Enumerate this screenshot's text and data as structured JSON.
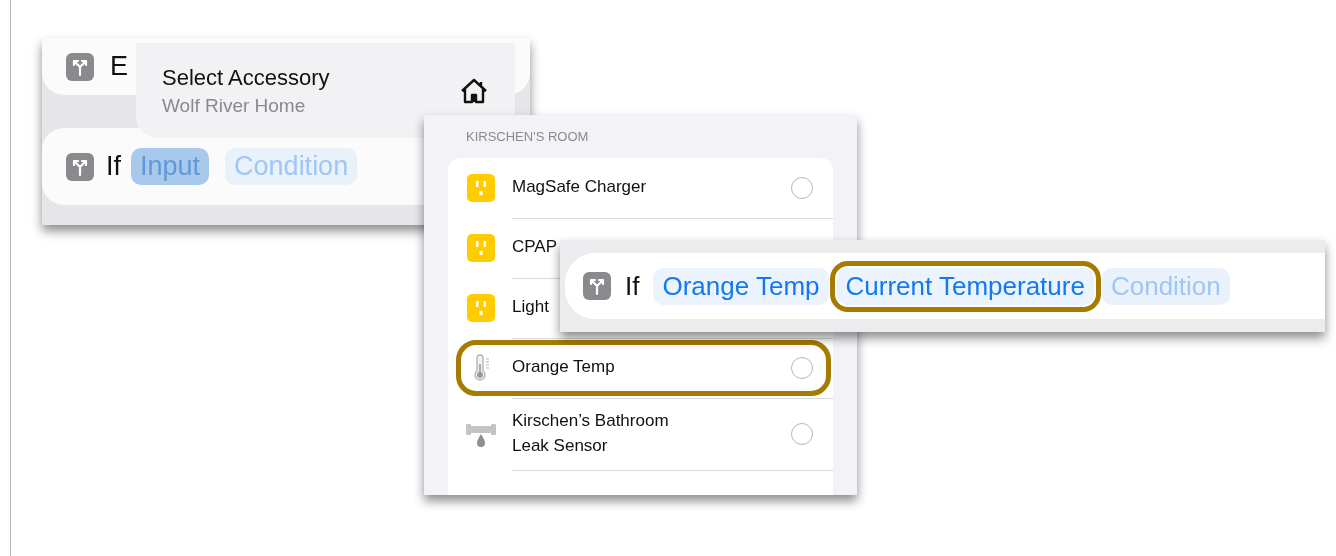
{
  "editor_panel": {
    "top_action": {
      "label": "E"
    },
    "if_action": {
      "label": "If",
      "tokens": [
        {
          "text": "Input",
          "kind": "selected",
          "highlighted": false
        },
        {
          "text": "Condition",
          "kind": "placeholder",
          "highlighted": false
        }
      ]
    }
  },
  "accessory_popup": {
    "title": "Select Accessory",
    "subtitle": "Wolf River Home"
  },
  "accessory_list": {
    "section": "KIRSCHEN'S ROOM",
    "items": [
      {
        "name": "MagSafe Charger",
        "kind": "outlet",
        "selected": false,
        "highlighted": false
      },
      {
        "name": "CPAP",
        "kind": "outlet",
        "highlighted": false
      },
      {
        "name": "Light",
        "kind": "outlet",
        "highlighted": false
      },
      {
        "name": "Orange Temp",
        "kind": "thermometer",
        "selected": false,
        "highlighted": true
      },
      {
        "name": "Kirschen’s Bathroom Leak Sensor",
        "kind": "leak-sensor",
        "selected": false,
        "highlighted": false
      }
    ]
  },
  "condition_bar": {
    "label": "If",
    "tokens": [
      {
        "text": "Orange Temp",
        "kind": "value",
        "highlighted": false
      },
      {
        "text": "Current Temperature",
        "kind": "value",
        "highlighted": true
      },
      {
        "text": "Condition",
        "kind": "placeholder",
        "highlighted": false
      }
    ]
  }
}
